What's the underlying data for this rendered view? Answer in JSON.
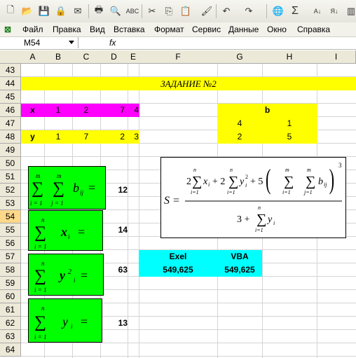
{
  "toolbar": {
    "icons": [
      "new-icon",
      "open-icon",
      "save-icon",
      "permission-icon",
      "mail-icon",
      "print-icon",
      "print-preview-icon",
      "spelling-icon",
      "cut-icon",
      "copy-icon",
      "paste-icon",
      "format-painter-icon",
      "undo-icon",
      "redo-icon",
      "hyperlink-icon",
      "autosum-icon",
      "sort-ascending-icon",
      "sort-descending-icon"
    ]
  },
  "menu": [
    "Файл",
    "Правка",
    "Вид",
    "Вставка",
    "Формат",
    "Сервис",
    "Данные",
    "Окно",
    "Справка"
  ],
  "namebox": "M54",
  "fx_label": "fx",
  "columns": [
    "A",
    "B",
    "C",
    "D",
    "E",
    "F",
    "G",
    "H",
    "I"
  ],
  "rows": [
    "43",
    "44",
    "45",
    "46",
    "47",
    "48",
    "49",
    "50",
    "51",
    "52",
    "53",
    "54",
    "55",
    "56",
    "57",
    "58",
    "59",
    "60",
    "61",
    "62",
    "63",
    "64"
  ],
  "selected_row": "54",
  "colors": {
    "yellow": "#ffff00",
    "magenta": "#ff00ff",
    "cyan": "#00ffff",
    "green": "#00ff00"
  },
  "title": "ЗАДАНИЕ №2",
  "x_row": {
    "label": "x",
    "values": [
      "1",
      "2",
      "7",
      "4"
    ]
  },
  "y_row": {
    "label": "y",
    "values": [
      "1",
      "7",
      "2",
      "3"
    ]
  },
  "b_table": {
    "header": "b",
    "r1": [
      "4",
      "1"
    ],
    "r2": [
      "2",
      "5"
    ]
  },
  "results": {
    "sum_b": "12",
    "sum_x": "14",
    "sum_y2": "63",
    "sum_y": "13"
  },
  "comparison": {
    "exel_label": "Exel",
    "vba_label": "VBA",
    "exel_value": "549,625",
    "vba_value": "549,625"
  },
  "formula": {
    "lhs": "S ="
  }
}
